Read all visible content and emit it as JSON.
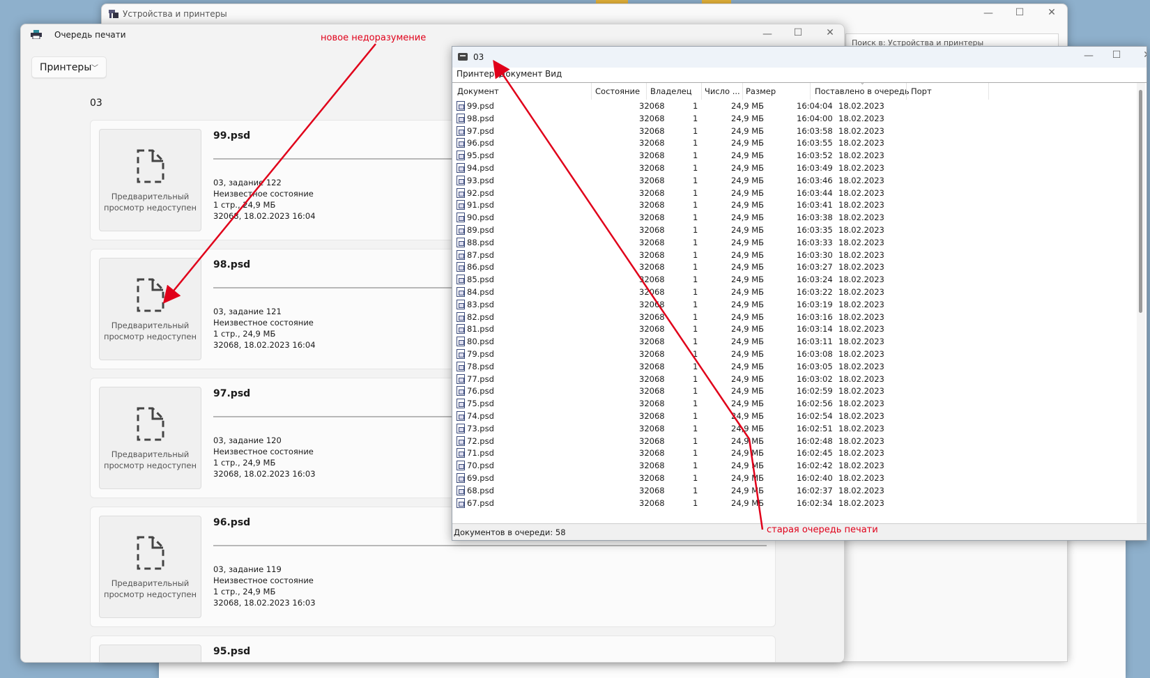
{
  "devices_window": {
    "title": "Устройства и принтеры",
    "search_placeholder": "Поиск в: Устройства и принтеры"
  },
  "print_queue_window": {
    "title": "Очередь печати",
    "printers_dropdown": "Принтеры",
    "printer_name": "03",
    "preview_unavailable": "Предварительный просмотр недоступен",
    "jobs": [
      {
        "file": "99.psd",
        "job": "03, задание 122",
        "status": "Неизвестное состояние",
        "size": "1 стр., 24,9 МБ",
        "owner_time": "32068, 18.02.2023 16:04"
      },
      {
        "file": "98.psd",
        "job": "03, задание 121",
        "status": "Неизвестное состояние",
        "size": "1 стр., 24,9 МБ",
        "owner_time": "32068, 18.02.2023 16:04"
      },
      {
        "file": "97.psd",
        "job": "03, задание 120",
        "status": "Неизвестное состояние",
        "size": "1 стр., 24,9 МБ",
        "owner_time": "32068, 18.02.2023 16:03"
      },
      {
        "file": "96.psd",
        "job": "03, задание 119",
        "status": "Неизвестное состояние",
        "size": "1 стр., 24,9 МБ",
        "owner_time": "32068, 18.02.2023 16:03"
      },
      {
        "file": "95.psd"
      }
    ]
  },
  "old_queue_window": {
    "title": "03",
    "menu": [
      "Принтер",
      "Документ",
      "Вид"
    ],
    "columns": [
      "Документ",
      "Состояние",
      "Владелец",
      "Число ...",
      "Размер",
      "Поставлено в очередь",
      "Порт"
    ],
    "rows": [
      {
        "name": "99.psd",
        "owner": "32068",
        "pages": "1",
        "size": "24,9 МБ",
        "time": "16:04:04",
        "date": "18.02.2023"
      },
      {
        "name": "98.psd",
        "owner": "32068",
        "pages": "1",
        "size": "24,9 МБ",
        "time": "16:04:00",
        "date": "18.02.2023"
      },
      {
        "name": "97.psd",
        "owner": "32068",
        "pages": "1",
        "size": "24,9 МБ",
        "time": "16:03:58",
        "date": "18.02.2023"
      },
      {
        "name": "96.psd",
        "owner": "32068",
        "pages": "1",
        "size": "24,9 МБ",
        "time": "16:03:55",
        "date": "18.02.2023"
      },
      {
        "name": "95.psd",
        "owner": "32068",
        "pages": "1",
        "size": "24,9 МБ",
        "time": "16:03:52",
        "date": "18.02.2023"
      },
      {
        "name": "94.psd",
        "owner": "32068",
        "pages": "1",
        "size": "24,9 МБ",
        "time": "16:03:49",
        "date": "18.02.2023"
      },
      {
        "name": "93.psd",
        "owner": "32068",
        "pages": "1",
        "size": "24,9 МБ",
        "time": "16:03:46",
        "date": "18.02.2023"
      },
      {
        "name": "92.psd",
        "owner": "32068",
        "pages": "1",
        "size": "24,9 МБ",
        "time": "16:03:44",
        "date": "18.02.2023"
      },
      {
        "name": "91.psd",
        "owner": "32068",
        "pages": "1",
        "size": "24,9 МБ",
        "time": "16:03:41",
        "date": "18.02.2023"
      },
      {
        "name": "90.psd",
        "owner": "32068",
        "pages": "1",
        "size": "24,9 МБ",
        "time": "16:03:38",
        "date": "18.02.2023"
      },
      {
        "name": "89.psd",
        "owner": "32068",
        "pages": "1",
        "size": "24,9 МБ",
        "time": "16:03:35",
        "date": "18.02.2023"
      },
      {
        "name": "88.psd",
        "owner": "32068",
        "pages": "1",
        "size": "24,9 МБ",
        "time": "16:03:33",
        "date": "18.02.2023"
      },
      {
        "name": "87.psd",
        "owner": "32068",
        "pages": "1",
        "size": "24,9 МБ",
        "time": "16:03:30",
        "date": "18.02.2023"
      },
      {
        "name": "86.psd",
        "owner": "32068",
        "pages": "1",
        "size": "24,9 МБ",
        "time": "16:03:27",
        "date": "18.02.2023"
      },
      {
        "name": "85.psd",
        "owner": "32068",
        "pages": "1",
        "size": "24,9 МБ",
        "time": "16:03:24",
        "date": "18.02.2023"
      },
      {
        "name": "84.psd",
        "owner": "32068",
        "pages": "1",
        "size": "24,9 МБ",
        "time": "16:03:22",
        "date": "18.02.2023"
      },
      {
        "name": "83.psd",
        "owner": "32068",
        "pages": "1",
        "size": "24,9 МБ",
        "time": "16:03:19",
        "date": "18.02.2023"
      },
      {
        "name": "82.psd",
        "owner": "32068",
        "pages": "1",
        "size": "24,9 МБ",
        "time": "16:03:16",
        "date": "18.02.2023"
      },
      {
        "name": "81.psd",
        "owner": "32068",
        "pages": "1",
        "size": "24,9 МБ",
        "time": "16:03:14",
        "date": "18.02.2023"
      },
      {
        "name": "80.psd",
        "owner": "32068",
        "pages": "1",
        "size": "24,9 МБ",
        "time": "16:03:11",
        "date": "18.02.2023"
      },
      {
        "name": "79.psd",
        "owner": "32068",
        "pages": "1",
        "size": "24,9 МБ",
        "time": "16:03:08",
        "date": "18.02.2023"
      },
      {
        "name": "78.psd",
        "owner": "32068",
        "pages": "1",
        "size": "24,9 МБ",
        "time": "16:03:05",
        "date": "18.02.2023"
      },
      {
        "name": "77.psd",
        "owner": "32068",
        "pages": "1",
        "size": "24,9 МБ",
        "time": "16:03:02",
        "date": "18.02.2023"
      },
      {
        "name": "76.psd",
        "owner": "32068",
        "pages": "1",
        "size": "24,9 МБ",
        "time": "16:02:59",
        "date": "18.02.2023"
      },
      {
        "name": "75.psd",
        "owner": "32068",
        "pages": "1",
        "size": "24,9 МБ",
        "time": "16:02:56",
        "date": "18.02.2023"
      },
      {
        "name": "74.psd",
        "owner": "32068",
        "pages": "1",
        "size": "24,9 МБ",
        "time": "16:02:54",
        "date": "18.02.2023"
      },
      {
        "name": "73.psd",
        "owner": "32068",
        "pages": "1",
        "size": "24,9 МБ",
        "time": "16:02:51",
        "date": "18.02.2023"
      },
      {
        "name": "72.psd",
        "owner": "32068",
        "pages": "1",
        "size": "24,9 МБ",
        "time": "16:02:48",
        "date": "18.02.2023"
      },
      {
        "name": "71.psd",
        "owner": "32068",
        "pages": "1",
        "size": "24,9 МБ",
        "time": "16:02:45",
        "date": "18.02.2023"
      },
      {
        "name": "70.psd",
        "owner": "32068",
        "pages": "1",
        "size": "24,9 МБ",
        "time": "16:02:42",
        "date": "18.02.2023"
      },
      {
        "name": "69.psd",
        "owner": "32068",
        "pages": "1",
        "size": "24,9 МБ",
        "time": "16:02:40",
        "date": "18.02.2023"
      },
      {
        "name": "68.psd",
        "owner": "32068",
        "pages": "1",
        "size": "24,9 МБ",
        "time": "16:02:37",
        "date": "18.02.2023"
      },
      {
        "name": "67.psd",
        "owner": "32068",
        "pages": "1",
        "size": "24,9 МБ",
        "time": "16:02:34",
        "date": "18.02.2023"
      }
    ],
    "status": "Документов в очереди: 58"
  },
  "annotations": {
    "new": "новое недоразумение",
    "old": "старая очередь печати",
    "color": "#e0001a"
  }
}
